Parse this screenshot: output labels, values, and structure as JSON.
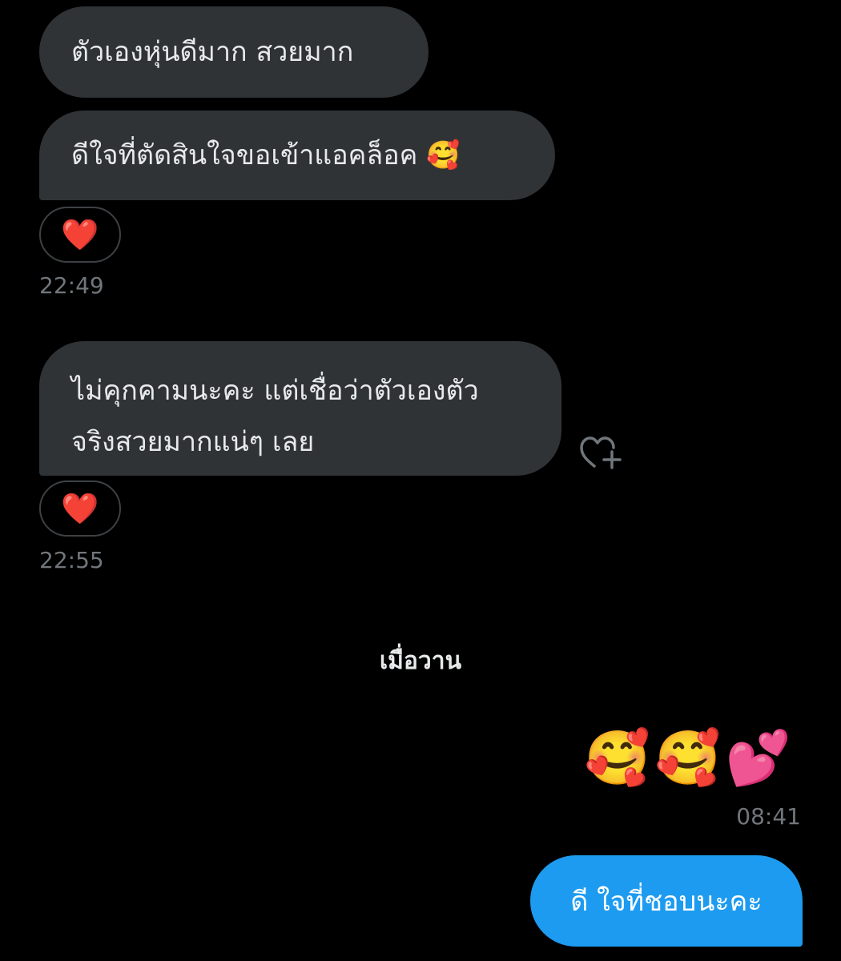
{
  "messages": [
    {
      "text": "ตัวเองหุ่นดีมาก สวยมาก"
    },
    {
      "text": "ดีใจที่ตัดสินใจขอเข้าแอคล็อค 🥰"
    },
    {
      "line1": "ไม่คุกคามนะคะ แต่เชื่อว่าตัวเองตัว",
      "line2": "จริงสวยมากแน่ๆ เลย"
    }
  ],
  "reactions": [
    "❤️",
    "❤️"
  ],
  "timestamps": [
    "22:49",
    "22:55",
    "08:41"
  ],
  "date_separator": "เมื่อวาน",
  "sent_emoji_message": "🥰🥰💕",
  "sent_text_message": "ดี ใจที่ชอบนะคะ",
  "colors": {
    "incoming_bubble": "#2f3336",
    "outgoing_bubble": "#1d9bf0",
    "background": "#000000",
    "muted_text": "#71767b"
  },
  "icons": {
    "add_reaction": "heart-plus-icon"
  }
}
